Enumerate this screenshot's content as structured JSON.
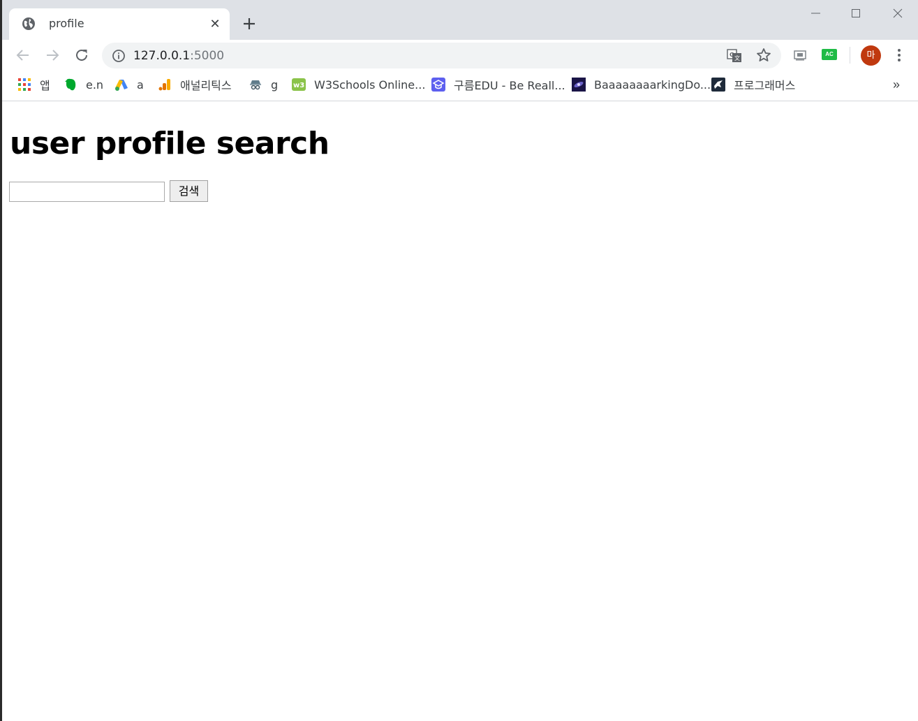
{
  "browser": {
    "tab": {
      "title": "profile",
      "close_glyph": "✕"
    },
    "new_tab_icon": "plus-icon",
    "address_bar": {
      "host": "127.0.0.1",
      "port": ":5000"
    },
    "profile_avatar": {
      "initial": "마",
      "color": "#c0390f"
    },
    "extensions": [
      {
        "name": "extension-screen-icon"
      },
      {
        "name": "extension-ac-icon",
        "label": "AC",
        "color": "#1fbb46"
      }
    ]
  },
  "bookmarks": {
    "items": [
      {
        "label": "앱",
        "icon": "apps-grid-icon"
      },
      {
        "label": "e.n",
        "icon": "evernote-icon"
      },
      {
        "label": "a",
        "icon": "google-ads-icon"
      },
      {
        "label": "애널리틱스",
        "icon": "analytics-icon"
      },
      {
        "label": "g",
        "icon": "spy-icon"
      },
      {
        "label": "W3Schools Online...",
        "icon": "w3schools-icon"
      },
      {
        "label": "구름EDU - Be Reall...",
        "icon": "goorm-icon"
      },
      {
        "label": "BaaaaaaaarkingDo...",
        "icon": "galaxy-icon"
      },
      {
        "label": "프로그래머스",
        "icon": "programmers-icon"
      }
    ],
    "more": "»"
  },
  "page": {
    "heading": "user profile search",
    "search": {
      "value": "",
      "placeholder": ""
    },
    "search_button": "검색"
  }
}
